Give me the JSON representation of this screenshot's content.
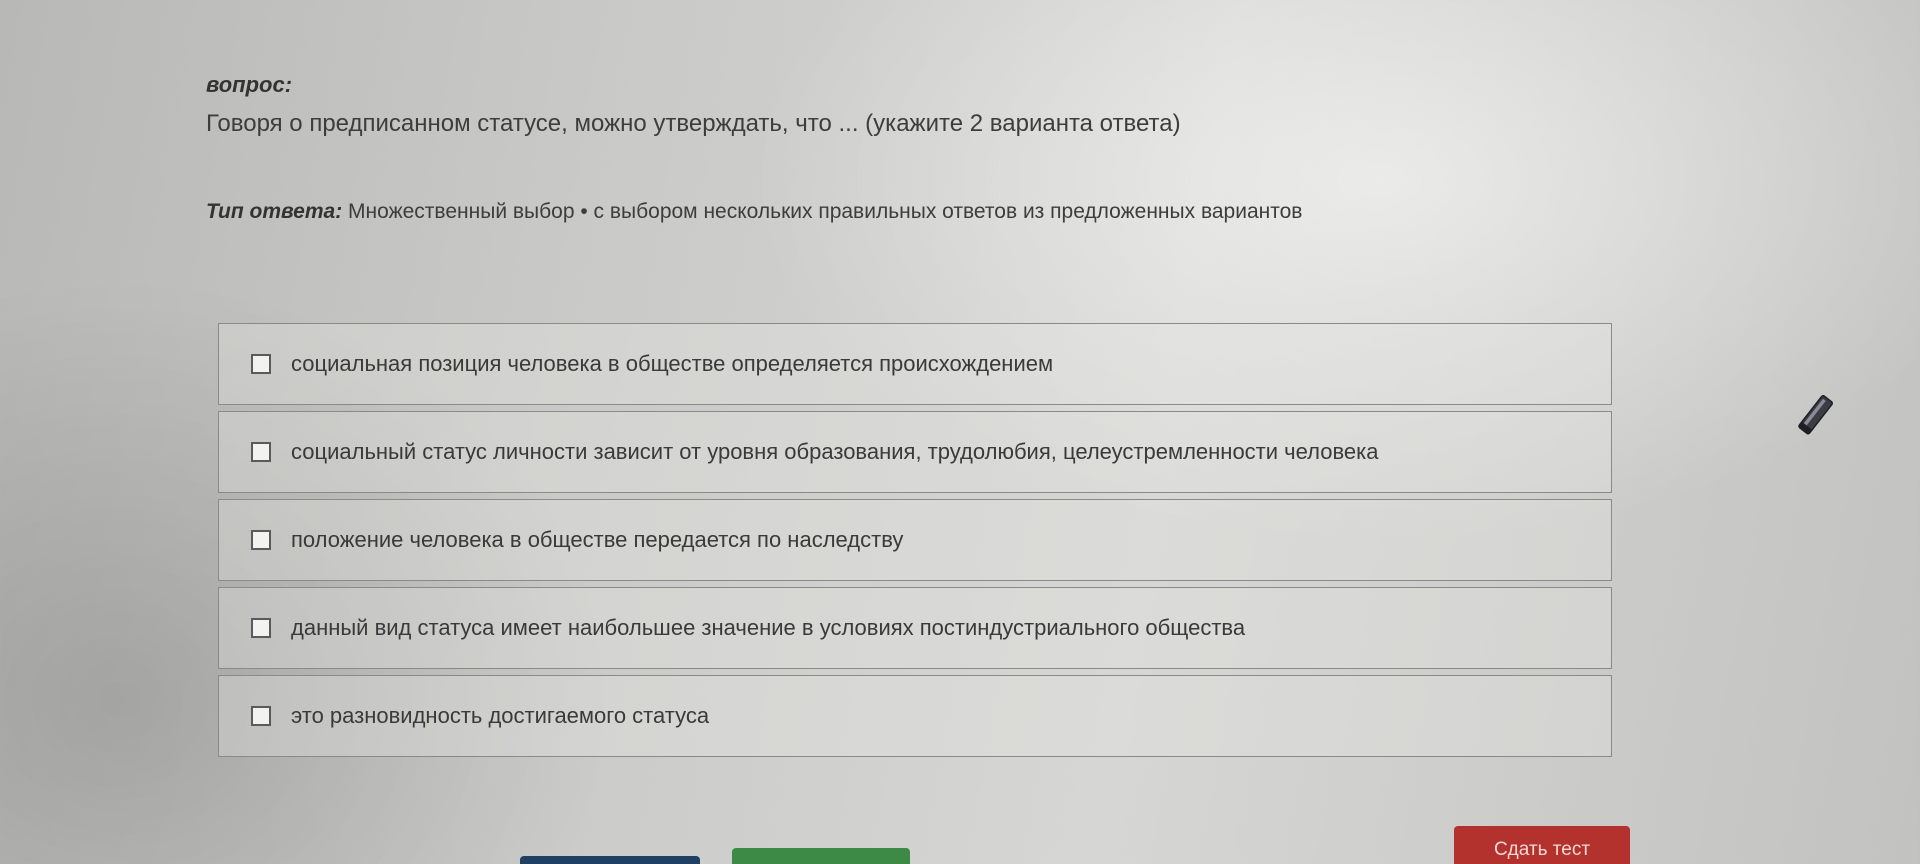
{
  "question": {
    "label": "вопрос:",
    "text": "Говоря о предписанном статусе, можно утверждать, что ... (укажите 2 варианта ответа)"
  },
  "answer_type": {
    "label": "Тип ответа:",
    "value": "Множественный выбор • с выбором нескольких правильных ответов из предложенных вариантов"
  },
  "options": [
    {
      "text": "социальная позиция человека в обществе определяется происхождением",
      "checked": false
    },
    {
      "text": "социальный статус личности зависит от уровня образования, трудолюбия, целеустремленности человека",
      "checked": false
    },
    {
      "text": "положение человека в обществе передается по наследству",
      "checked": false
    },
    {
      "text": "данный вид статуса имеет наибольшее значение в условиях постиндустриального общества",
      "checked": false
    },
    {
      "text": "это разновидность достигаемого статуса",
      "checked": false
    }
  ],
  "buttons": {
    "submit_label": "Сдать тест"
  },
  "colors": {
    "submit": "#b4322d",
    "nav_green": "#3c8a45",
    "nav_blue": "#1f3f63"
  },
  "icons": {
    "cursor": "pencil-cursor-icon"
  }
}
